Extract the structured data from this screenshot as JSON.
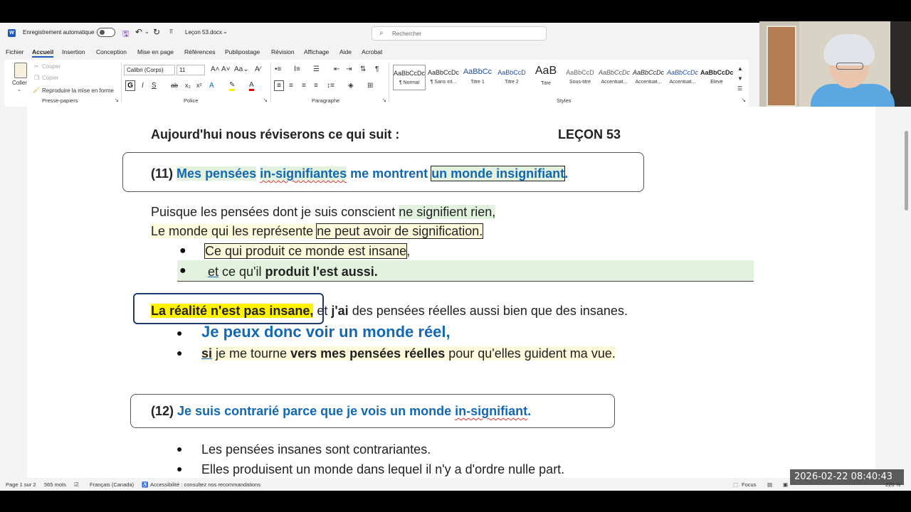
{
  "titlebar": {
    "autosave_label": "Enregistrement automatique",
    "filename": "Leçon 53.docx",
    "search_placeholder": "Rechercher"
  },
  "menu": [
    "Fichier",
    "Accueil",
    "Insertion",
    "Conception",
    "Mise en page",
    "Références",
    "Publipostage",
    "Révision",
    "Affichage",
    "Aide",
    "Acrobat"
  ],
  "ribbon": {
    "clipboard": {
      "paste": "Coller",
      "cut": "Couper",
      "copy": "Copier",
      "format_painter": "Reproduire la mise en forme",
      "group": "Presse-papiers"
    },
    "font": {
      "name": "Calibri (Corps)",
      "size": "11",
      "group": "Police"
    },
    "paragraph": {
      "group": "Paragraphe"
    },
    "styles": {
      "group": "Styles",
      "items": [
        {
          "preview": "AaBbCcDc",
          "name": "¶ Normal"
        },
        {
          "preview": "AaBbCcDc",
          "name": "¶ Sans int..."
        },
        {
          "preview": "AaBbCc",
          "name": "Titre 1"
        },
        {
          "preview": "AaBbCcD",
          "name": "Titre 2"
        },
        {
          "preview": "AaB",
          "name": "Titre"
        },
        {
          "preview": "AaBbCcD",
          "name": "Sous-titre"
        },
        {
          "preview": "AaBbCcDc",
          "name": "Accentuat..."
        },
        {
          "preview": "AaBbCcDc",
          "name": "Accentuat..."
        },
        {
          "preview": "AaBbCcDc",
          "name": "Accentuat..."
        },
        {
          "preview": "AaBbCcDc",
          "name": "Élevé"
        }
      ]
    }
  },
  "doc": {
    "heading_left": "Aujourd'hui nous réviserons ce qui suit :",
    "heading_right": "LEÇON 53",
    "s11": {
      "num": "(11)",
      "a": "Mes pensées",
      "b": "in-signifiantes",
      "c": "me montrent",
      "d": "un monde insignifiant",
      "e": "."
    },
    "p1": {
      "a": "Puisque les pensées dont je suis conscient ",
      "b": "ne signifient rien,"
    },
    "p2": {
      "a": " Le monde qui les représente ",
      "b": "ne peut avoir de signification."
    },
    "bul1": {
      "a": "Ce qui produit ce monde est insane",
      ",": ","
    },
    "bul2": {
      "a": "et",
      "b": " ce qu'il ",
      "c": "produit l'est aussi."
    },
    "p3": {
      "a": "La réalité n'est pas insane,",
      "b": " et ",
      "c": "j'ai",
      "d": " des pensées réelles aussi bien que des insanes."
    },
    "bul3": "Je peux donc voir un monde réel,",
    "bul4": {
      "a": "si",
      "b": " je me tourne ",
      "c": "vers mes pensées réelles",
      "d": " pour qu'elles guident ma vue."
    },
    "s12": {
      "num": "(12)",
      "a": "Je suis contrarié parce que je vois un monde ",
      "b": "in-signifiant",
      "c": "."
    },
    "bul5": "Les pensées insanes sont contrariantes.",
    "bul6": "Elles produisent un monde dans lequel il n'y a d'ordre nulle part."
  },
  "status": {
    "page": "Page 1 sur 2",
    "words": "565 mots",
    "language": "Français (Canada)",
    "accessibility": "Accessibilité : consultez nos recommandations",
    "focus": "Focus",
    "zoom": "220 %"
  },
  "clock": "2026-02-22  08:40:43",
  "colors": {
    "accent": "#185abd",
    "doc_blue": "#1368b3",
    "highlight_green": "#e3f1df",
    "highlight_yellow": "#fefadc",
    "highlight_bright": "#fff200"
  }
}
